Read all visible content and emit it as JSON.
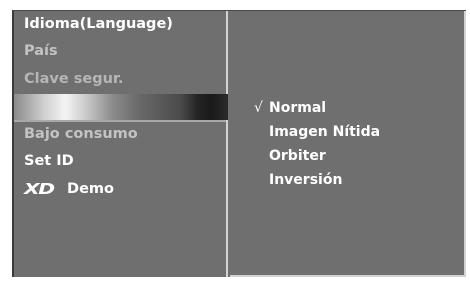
{
  "left_menu": {
    "items": [
      {
        "label": "Idioma(Language)"
      },
      {
        "label": "País"
      },
      {
        "label": "Clave segur."
      },
      {
        "label": ""
      },
      {
        "label": "Bajo consumo"
      },
      {
        "label": "Set ID"
      },
      {
        "logo_text": "XD",
        "label": "Demo"
      }
    ]
  },
  "submenu": {
    "check_mark": "√",
    "selected_index": 0,
    "options": [
      "Normal",
      "Imagen Nítida",
      "Orbiter",
      "Inversión"
    ]
  },
  "colors": {
    "panel": "#6f6f6f",
    "text": "#ffffff",
    "dim_text": "#c3c3c3",
    "border": "#d2d2d2"
  }
}
